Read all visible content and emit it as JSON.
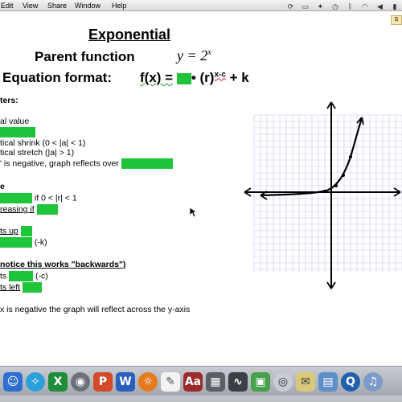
{
  "menubar": {
    "items": [
      "Edit",
      "View",
      "Share",
      "Window",
      "Help"
    ]
  },
  "document": {
    "side_tag": "S",
    "title": "Exponential",
    "parent_label": "Parent function",
    "parent_equation_base": "y = 2",
    "parent_equation_exp": "x",
    "format_label": "Equation format:",
    "formula": {
      "prefix": "f(x) =",
      "middle": "• (r)",
      "exponent": "x-c",
      "suffix": "+ k"
    },
    "lines": [
      "ters:",
      "al value",
      "tical shrink (0 < |a| < 1)",
      "tical stretch (|a| > 1)",
      "' is negative, graph reflects over",
      "e",
      "if 0 < |r| < 1",
      "reasing if",
      "ts up",
      "(-k)",
      "notice this works \"backwards\")",
      "ts",
      "(-c)",
      "ts left",
      "x is negative the graph will reflect across the y-axis"
    ],
    "highlight_color": "#1ec43a"
  },
  "dock": {
    "icons": [
      "finder-icon",
      "safari-icon",
      "excel-icon",
      "webcam-icon",
      "powerpoint-icon",
      "word-icon",
      "firefox-icon",
      "textedit-icon",
      "dictionary-icon",
      "calculator-icon",
      "grapher-icon",
      "dvd-player-icon",
      "preview-icon",
      "photo-booth-icon",
      "quicktime-icon",
      "itunes-icon"
    ]
  }
}
